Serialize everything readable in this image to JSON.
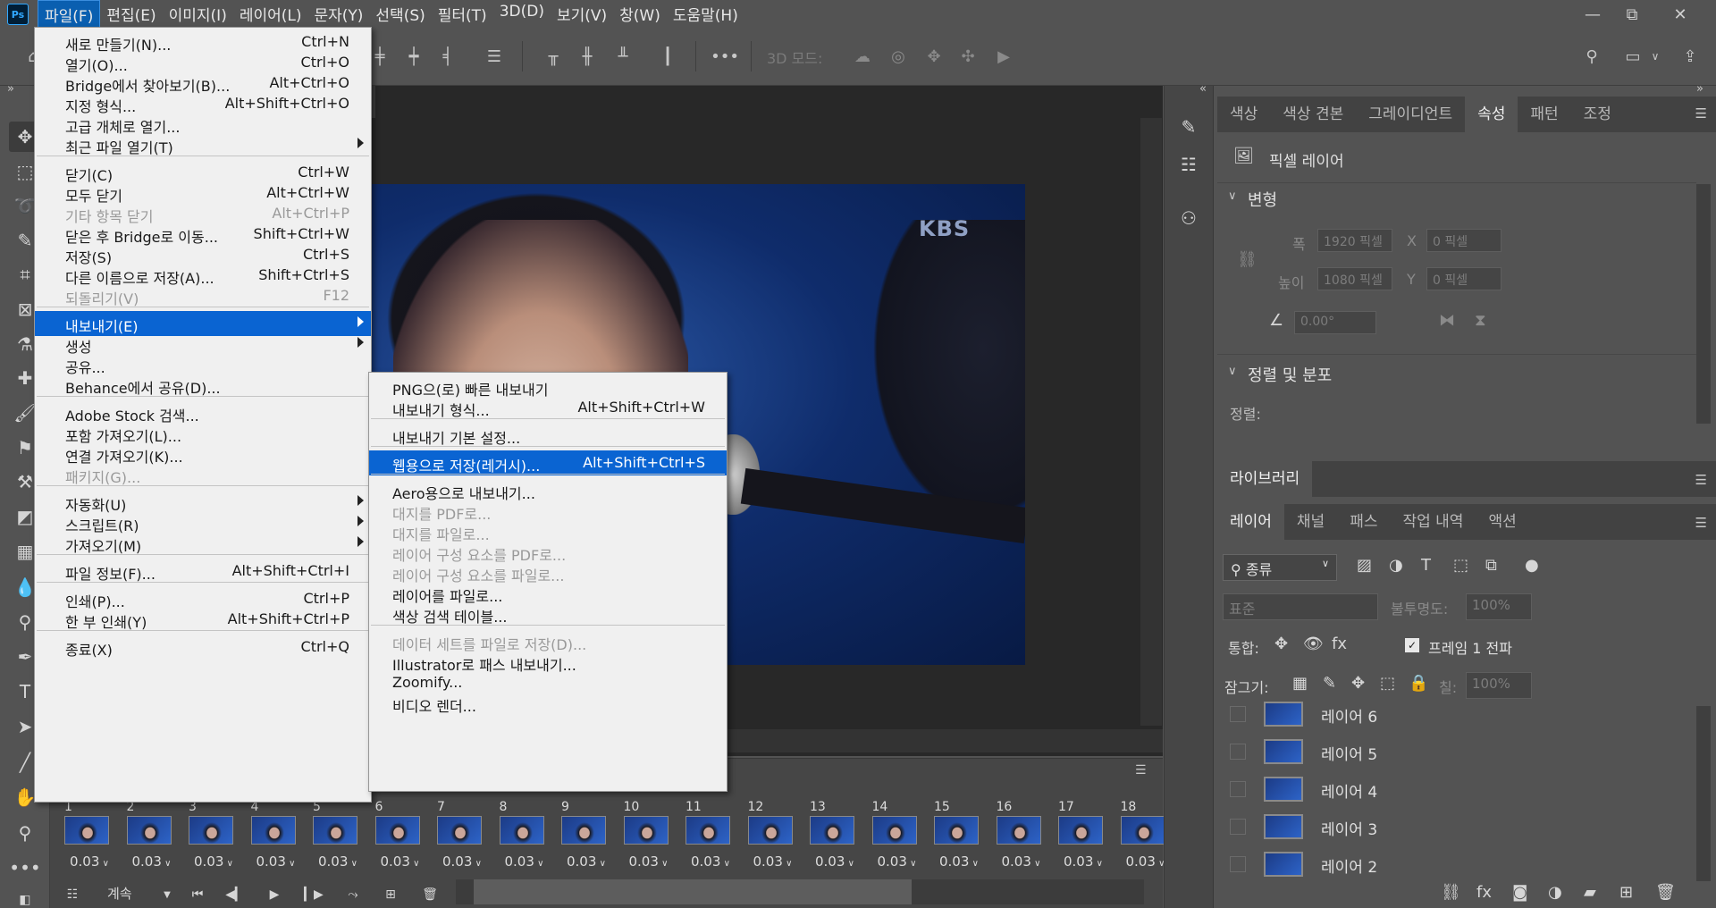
{
  "app": {
    "logo": "Ps"
  },
  "menubar": [
    {
      "label": "파일(F)",
      "active": true
    },
    {
      "label": "편집(E)"
    },
    {
      "label": "이미지(I)"
    },
    {
      "label": "레이어(L)"
    },
    {
      "label": "문자(Y)"
    },
    {
      "label": "선택(S)"
    },
    {
      "label": "필터(T)"
    },
    {
      "label": "3D(D)"
    },
    {
      "label": "보기(V)"
    },
    {
      "label": "창(W)"
    },
    {
      "label": "도움말(H)"
    }
  ],
  "window_controls": {
    "minimize": "—",
    "restore": "⧉",
    "close": "✕"
  },
  "options_bar": {
    "mode3d_label": "3D 모드:",
    "more": "•••"
  },
  "canvas": {
    "watermark": "KBS"
  },
  "file_menu": {
    "items": [
      {
        "label": "새로 만들기(N)...",
        "shortcut": "Ctrl+N"
      },
      {
        "label": "열기(O)...",
        "shortcut": "Ctrl+O"
      },
      {
        "label": "Bridge에서 찾아보기(B)...",
        "shortcut": "Alt+Ctrl+O"
      },
      {
        "label": "지정 형식...",
        "shortcut": "Alt+Shift+Ctrl+O"
      },
      {
        "label": "고급 개체로 열기...",
        "shortcut": ""
      },
      {
        "label": "최근 파일 열기(T)",
        "shortcut": "",
        "submenu": true
      },
      {
        "separator": true
      },
      {
        "label": "닫기(C)",
        "shortcut": "Ctrl+W"
      },
      {
        "label": "모두 닫기",
        "shortcut": "Alt+Ctrl+W"
      },
      {
        "label": "기타 항목 닫기",
        "shortcut": "Alt+Ctrl+P",
        "disabled": true
      },
      {
        "label": "닫은 후 Bridge로 이동...",
        "shortcut": "Shift+Ctrl+W"
      },
      {
        "label": "저장(S)",
        "shortcut": "Ctrl+S"
      },
      {
        "label": "다른 이름으로 저장(A)...",
        "shortcut": "Shift+Ctrl+S"
      },
      {
        "label": "되돌리기(V)",
        "shortcut": "F12",
        "disabled": true
      },
      {
        "separator": true
      },
      {
        "label": "내보내기(E)",
        "shortcut": "",
        "submenu": true,
        "selected": true
      },
      {
        "label": "생성",
        "shortcut": "",
        "submenu": true
      },
      {
        "label": "공유...",
        "shortcut": ""
      },
      {
        "label": "Behance에서 공유(D)...",
        "shortcut": ""
      },
      {
        "separator": true
      },
      {
        "label": "Adobe Stock 검색...",
        "shortcut": ""
      },
      {
        "label": "포함 가져오기(L)...",
        "shortcut": ""
      },
      {
        "label": "연결 가져오기(K)...",
        "shortcut": ""
      },
      {
        "label": "패키지(G)...",
        "shortcut": "",
        "disabled": true
      },
      {
        "separator": true
      },
      {
        "label": "자동화(U)",
        "shortcut": "",
        "submenu": true
      },
      {
        "label": "스크립트(R)",
        "shortcut": "",
        "submenu": true
      },
      {
        "label": "가져오기(M)",
        "shortcut": "",
        "submenu": true
      },
      {
        "separator": true
      },
      {
        "label": "파일 정보(F)...",
        "shortcut": "Alt+Shift+Ctrl+I"
      },
      {
        "separator": true
      },
      {
        "label": "인쇄(P)...",
        "shortcut": "Ctrl+P"
      },
      {
        "label": "한 부 인쇄(Y)",
        "shortcut": "Alt+Shift+Ctrl+P"
      },
      {
        "separator": true
      },
      {
        "label": "종료(X)",
        "shortcut": "Ctrl+Q"
      }
    ]
  },
  "export_submenu": {
    "items": [
      {
        "label": "PNG으(로) 빠른 내보내기",
        "shortcut": ""
      },
      {
        "label": "내보내기 형식...",
        "shortcut": "Alt+Shift+Ctrl+W"
      },
      {
        "separator": true
      },
      {
        "label": "내보내기 기본 설정...",
        "shortcut": ""
      },
      {
        "separator": true
      },
      {
        "label": "웹용으로 저장(레거시)...",
        "shortcut": "Alt+Shift+Ctrl+S",
        "selected": true
      },
      {
        "separator": true
      },
      {
        "label": "Aero용으로 내보내기...",
        "shortcut": ""
      },
      {
        "label": "대지를 PDF로...",
        "shortcut": "",
        "disabled": true
      },
      {
        "label": "대지를 파일로...",
        "shortcut": "",
        "disabled": true
      },
      {
        "label": "레이어 구성 요소를 PDF로...",
        "shortcut": "",
        "disabled": true
      },
      {
        "label": "레이어 구성 요소를 파일로...",
        "shortcut": "",
        "disabled": true
      },
      {
        "label": "레이어를 파일로...",
        "shortcut": ""
      },
      {
        "label": "색상 검색 테이블...",
        "shortcut": ""
      },
      {
        "separator": true
      },
      {
        "label": "데이터 세트를 파일로 저장(D)...",
        "shortcut": "",
        "disabled": true
      },
      {
        "label": "Illustrator로 패스 내보내기...",
        "shortcut": ""
      },
      {
        "label": "Zoomify...",
        "shortcut": ""
      },
      {
        "label": "비디오 렌더...",
        "shortcut": ""
      }
    ]
  },
  "timeline": {
    "frames": [
      {
        "num": "1",
        "delay": "0.03"
      },
      {
        "num": "2",
        "delay": "0.03"
      },
      {
        "num": "3",
        "delay": "0.03"
      },
      {
        "num": "4",
        "delay": "0.03"
      },
      {
        "num": "5",
        "delay": "0.03"
      },
      {
        "num": "6",
        "delay": "0.03"
      },
      {
        "num": "7",
        "delay": "0.03"
      },
      {
        "num": "8",
        "delay": "0.03"
      },
      {
        "num": "9",
        "delay": "0.03"
      },
      {
        "num": "10",
        "delay": "0.03"
      },
      {
        "num": "11",
        "delay": "0.03"
      },
      {
        "num": "12",
        "delay": "0.03"
      },
      {
        "num": "13",
        "delay": "0.03"
      },
      {
        "num": "14",
        "delay": "0.03"
      },
      {
        "num": "15",
        "delay": "0.03"
      },
      {
        "num": "16",
        "delay": "0.03"
      },
      {
        "num": "17",
        "delay": "0.03"
      },
      {
        "num": "18",
        "delay": "0.03"
      }
    ],
    "loop_label": "계속"
  },
  "properties_panel": {
    "tabs": [
      {
        "label": "색상"
      },
      {
        "label": "색상 견본"
      },
      {
        "label": "그레이디언트"
      },
      {
        "label": "속성",
        "active": true
      },
      {
        "label": "패턴"
      },
      {
        "label": "조정"
      }
    ],
    "layer_type": "픽셀 레이어",
    "transform_title": "변형",
    "width_label": "폭",
    "width_value": "1920 픽셀",
    "height_label": "높이",
    "height_value": "1080 픽셀",
    "x_label": "X",
    "x_value": "0 픽셀",
    "y_label": "Y",
    "y_value": "0 픽셀",
    "angle_value": "0.00°",
    "align_title": "정렬 및 분포",
    "align_label": "정렬:"
  },
  "libraries_panel": {
    "title": "라이브러리"
  },
  "layers_panel": {
    "tabs": [
      {
        "label": "레이어",
        "active": true
      },
      {
        "label": "채널"
      },
      {
        "label": "패스"
      },
      {
        "label": "작업 내역"
      },
      {
        "label": "액션"
      }
    ],
    "filter_label": "종류",
    "blend_mode": "표준",
    "opacity_label": "불투명도:",
    "opacity_value": "100%",
    "unify_label": "통합:",
    "propagate_label": "프레임 1 전파",
    "lock_label": "잠그기:",
    "fill_label": "칠:",
    "fill_value": "100%",
    "layers": [
      {
        "name": "레이어 6"
      },
      {
        "name": "레이어 5"
      },
      {
        "name": "레이어 4"
      },
      {
        "name": "레이어 3"
      },
      {
        "name": "레이어 2"
      }
    ]
  }
}
